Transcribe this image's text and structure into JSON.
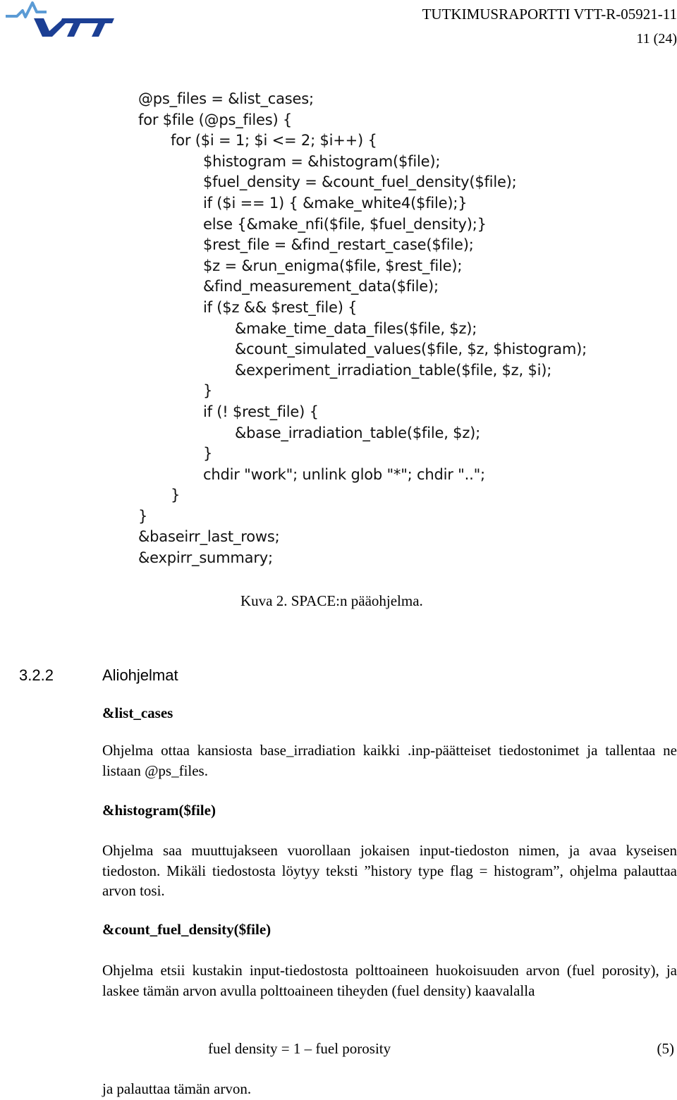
{
  "header": {
    "logo_label": "VTT",
    "brand_colors": {
      "dark_blue": "#1c3f94",
      "light_blue": "#5b9bd5"
    },
    "report_id": "TUTKIMUSRAPORTTI VTT-R-05921-11",
    "page_number": "11 (24)"
  },
  "figure": {
    "code_lines": [
      {
        "indent": 0,
        "text": "@ps_files = &list_cases;"
      },
      {
        "indent": 0,
        "text": "for $file (@ps_files) {"
      },
      {
        "indent": 1,
        "text": "for ($i = 1; $i <= 2; $i++) {"
      },
      {
        "indent": 2,
        "text": "$histogram = &histogram($file);"
      },
      {
        "indent": 2,
        "text": "$fuel_density = &count_fuel_density($file);"
      },
      {
        "indent": 2,
        "text": "if ($i == 1) { &make_white4($file);}"
      },
      {
        "indent": 2,
        "text": "else {&make_nfi($file, $fuel_density);}"
      },
      {
        "indent": 2,
        "text": "$rest_file = &find_restart_case($file);"
      },
      {
        "indent": 2,
        "text": "$z = &run_enigma($file, $rest_file);"
      },
      {
        "indent": 2,
        "text": "&find_measurement_data($file);"
      },
      {
        "indent": 2,
        "text": "if ($z && $rest_file) {"
      },
      {
        "indent": 3,
        "text": "&make_time_data_files($file, $z);"
      },
      {
        "indent": 3,
        "text": "&count_simulated_values($file, $z, $histogram);"
      },
      {
        "indent": 3,
        "text": "&experiment_irradiation_table($file, $z, $i);"
      },
      {
        "indent": 2,
        "text": "}"
      },
      {
        "indent": 2,
        "text": "if (! $rest_file) {"
      },
      {
        "indent": 3,
        "text": "&base_irradiation_table($file, $z);"
      },
      {
        "indent": 2,
        "text": "}"
      },
      {
        "indent": 2,
        "text": "chdir \"work\"; unlink glob \"*\"; chdir \"..\";"
      },
      {
        "indent": 1,
        "text": "}"
      },
      {
        "indent": 0,
        "text": "}"
      },
      {
        "indent": 0,
        "text": "&baseirr_last_rows;"
      },
      {
        "indent": 0,
        "text": "&expirr_summary;"
      }
    ],
    "caption": "Kuva 2. SPACE:n pääohjelma."
  },
  "section": {
    "number": "3.2.2",
    "title": "Aliohjelmat",
    "subsections": [
      {
        "heading": "&list_cases",
        "paragraph": "Ohjelma ottaa kansiosta base_irradiation kaikki .inp-päätteiset tiedostonimet ja tallentaa ne listaan @ps_files."
      },
      {
        "heading": "&histogram($file)",
        "paragraph": "Ohjelma saa muuttujakseen vuorollaan jokaisen input-tiedoston nimen, ja avaa kyseisen tiedoston. Mikäli tiedostosta löytyy teksti ”history type flag = histogram”, ohjelma palauttaa arvon tosi."
      },
      {
        "heading": "&count_fuel_density($file)",
        "paragraph": "Ohjelma etsii kustakin input-tiedostosta polttoaineen huokoisuuden arvon (fuel porosity), ja laskee tämän arvon avulla polttoaineen tiheyden (fuel density) kaavalalla"
      }
    ],
    "equation": {
      "text": "fuel density = 1 – fuel porosity",
      "number": "(5)"
    },
    "closing_text": "ja palauttaa tämän arvon."
  }
}
